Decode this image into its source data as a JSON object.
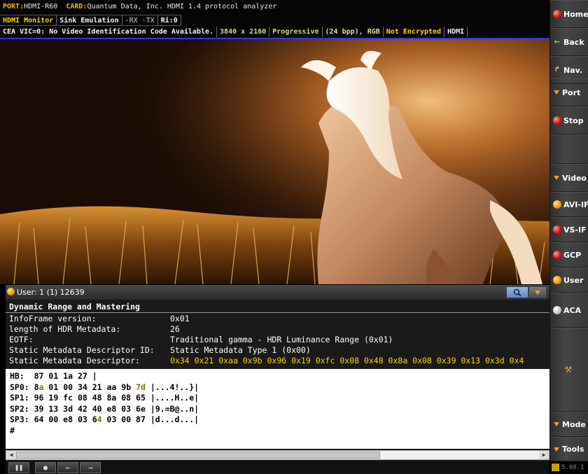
{
  "header": {
    "port_label": "PORT:",
    "port_value": "HDMI-R60",
    "card_label": "CARD:",
    "card_value": "Quantum Data, Inc. HDMI 1.4 protocol analyzer",
    "row2": [
      "HDMI Monitor",
      "Sink Emulation",
      "-RX -TX",
      "Ri:0"
    ],
    "row3": {
      "vic": "CEA VIC=0: No Video Identification Code Available.",
      "resolution": "3840 x 2160",
      "scan": "Progressive",
      "bpp": "(24 bpp), RGB",
      "encryption": "Not Encrypted",
      "mode": "HDMI"
    }
  },
  "sidebar": {
    "items": [
      {
        "label": "Home",
        "icon": "home-icon"
      },
      {
        "label": "Back",
        "icon": "back-arrow-icon"
      },
      {
        "label": "Nav.",
        "icon": "nav-icon"
      },
      {
        "label": "Port",
        "icon": "dropdown-triangle-icon"
      },
      {
        "label": "Stop",
        "icon": "stop-icon"
      },
      {
        "label": "",
        "icon": ""
      },
      {
        "label": "Video",
        "icon": "dropdown-triangle-icon"
      },
      {
        "label": "AVI-IF",
        "icon": "orange-ball-icon"
      },
      {
        "label": "VS-IF",
        "icon": "red-ball-icon"
      },
      {
        "label": "GCP",
        "icon": "red-ball-icon"
      },
      {
        "label": "User",
        "icon": "orange-ball-icon"
      },
      {
        "label": "ACA",
        "icon": "gray-ball-icon"
      },
      {
        "label": "",
        "icon": "wrench-icon"
      },
      {
        "label": "Mode",
        "icon": "dropdown-triangle-icon"
      },
      {
        "label": "Tools",
        "icon": "dropdown-triangle-icon"
      }
    ],
    "version": "5.08.1"
  },
  "panel": {
    "title": "User: 1 (1) 12639",
    "section": "Dynamic Range and Mastering",
    "fields": [
      {
        "label": "InfoFrame version:",
        "value": "0x01"
      },
      {
        "label": "length of HDR Metadata:",
        "value": "26"
      },
      {
        "label": "EOTF:",
        "value": "Traditional gamma - HDR Luminance Range (0x01)"
      },
      {
        "label": "Static Metadata Descriptor ID:",
        "value": "Static Metadata Type 1 (0x00)"
      },
      {
        "label": "Static Metadata Descriptor:",
        "value": "0x34 0x21 0xaa 0x9b 0x96 0x19 0xfc 0x08 0x48 0x8a 0x08 0x39 0x13 0x3d 0x4"
      }
    ],
    "hex": [
      {
        "label": "HB: ",
        "bytes": " 87 01 1a 27 |",
        "ascii": ""
      },
      {
        "label": "SP0: ",
        "pre": "8",
        "o1": "a",
        "bytes": " 01 00 34 21 aa 9b ",
        "o2": "7d",
        "ascii": " |...4!..}|"
      },
      {
        "label": "SP1: ",
        "pre": "96",
        "o1": "",
        "bytes": " 19 fc 08 48 8a 08 65",
        "o2": "",
        "ascii": " |....H..e|"
      },
      {
        "label": "SP2: ",
        "pre": "39",
        "o1": "",
        "bytes": " 13 3d 42 40 e8 03 6e",
        "o2": "",
        "ascii": " |9.=B@..n|"
      },
      {
        "label": "SP3: ",
        "pre": "64",
        "o1": "",
        "bytes": " 00 e8 03 6",
        "o2": "4",
        "ascii": " 03 00 87 |d...d...|"
      },
      {
        "label": "#",
        "pre": "",
        "o1": "",
        "bytes": "",
        "o2": "",
        "ascii": ""
      }
    ]
  },
  "colors": {
    "accent_yellow": "#ffd200",
    "header_orange": "#f0b020",
    "divider_blue": "#2b3bd8"
  }
}
